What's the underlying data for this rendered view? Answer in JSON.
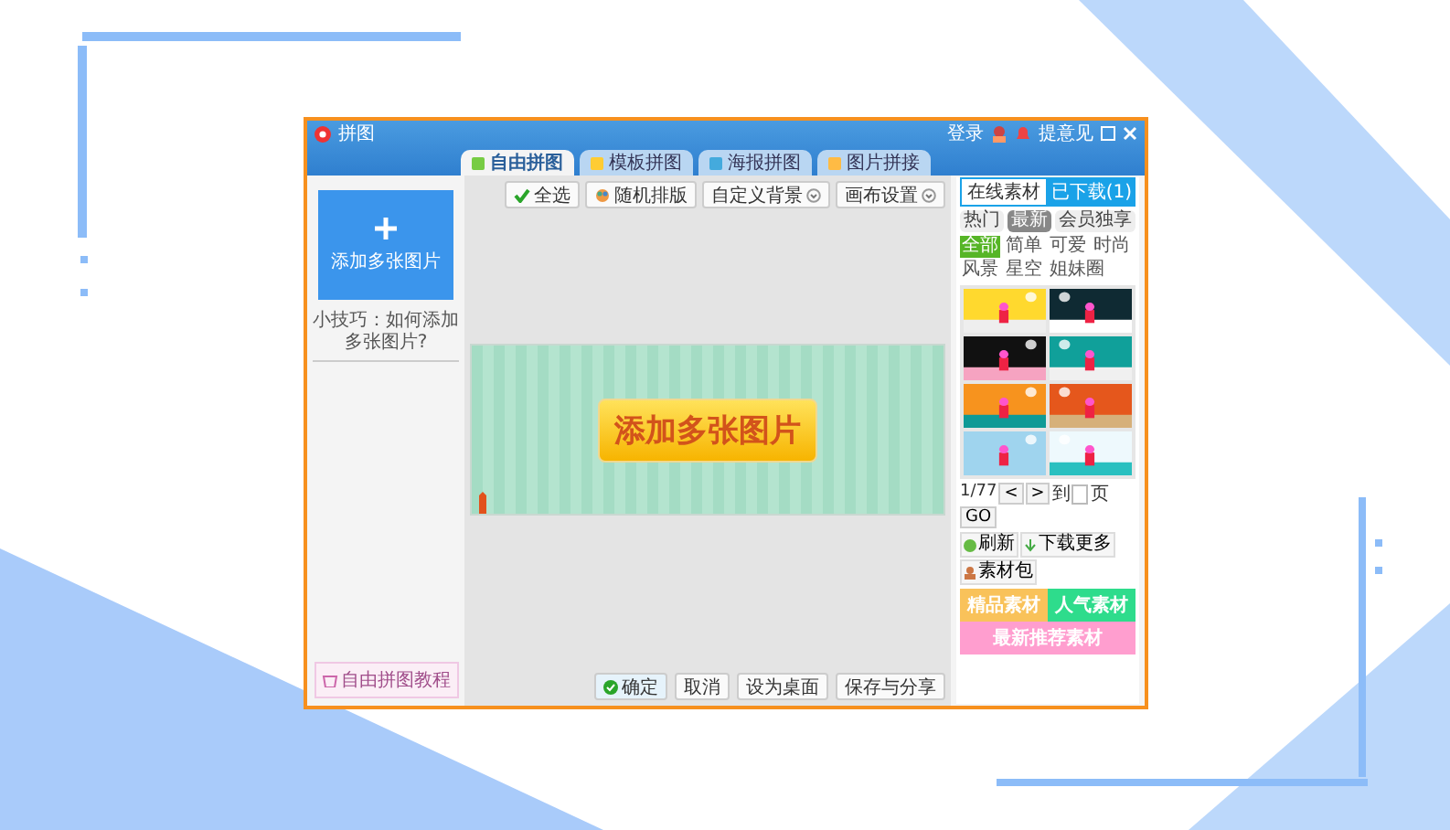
{
  "window": {
    "title": "拼图",
    "login": "登录",
    "feedback": "提意见"
  },
  "tabs": [
    {
      "label": "自由拼图",
      "selected": true
    },
    {
      "label": "模板拼图",
      "selected": false
    },
    {
      "label": "海报拼图",
      "selected": false
    },
    {
      "label": "图片拼接",
      "selected": false
    }
  ],
  "left_panel": {
    "add_button": "添加多张图片",
    "tip": "小技巧：如何添加多张图片?",
    "tutorial": "自由拼图教程"
  },
  "toolbar": [
    {
      "label": "全选",
      "kind": "check"
    },
    {
      "label": "随机排版",
      "kind": "shuffle"
    },
    {
      "label": "自定义背景",
      "kind": "dropdown"
    },
    {
      "label": "画布设置",
      "kind": "dropdown"
    }
  ],
  "canvas": {
    "prompt": "添加多张图片"
  },
  "material_panel": {
    "tabs": [
      {
        "label": "在线素材",
        "selected": true
      },
      {
        "label": "已下载(1)",
        "selected": false
      }
    ],
    "filters": [
      {
        "label": "热门",
        "selected": false
      },
      {
        "label": "最新",
        "selected": true
      },
      {
        "label": "会员独享",
        "selected": false
      }
    ],
    "categories": [
      {
        "label": "全部",
        "selected": true
      },
      {
        "label": "简单",
        "selected": false
      },
      {
        "label": "可爱",
        "selected": false
      },
      {
        "label": "时尚",
        "selected": false
      },
      {
        "label": "风景",
        "selected": false
      },
      {
        "label": "星空",
        "selected": false
      },
      {
        "label": "姐妹圈",
        "selected": false
      }
    ],
    "pager": {
      "page": "1/77",
      "prev": "<",
      "next": ">",
      "goto": "到",
      "unit": "页",
      "go": "GO"
    },
    "links": [
      {
        "label": "刷新",
        "kind": "refresh"
      },
      {
        "label": "下载更多",
        "kind": "download"
      },
      {
        "label": "素材包",
        "kind": "pack"
      }
    ],
    "banners": [
      {
        "label": "精品素材",
        "color": "#f9c25a"
      },
      {
        "label": "人气素材",
        "color": "#2edc8c"
      },
      {
        "label": "最新推荐素材",
        "color": "#ff9ecf"
      }
    ]
  },
  "bottom_buttons": [
    {
      "label": "确定",
      "kind": "primary"
    },
    {
      "label": "取消",
      "kind": "plain"
    },
    {
      "label": "设为桌面",
      "kind": "plain"
    },
    {
      "label": "保存与分享",
      "kind": "plain"
    }
  ]
}
